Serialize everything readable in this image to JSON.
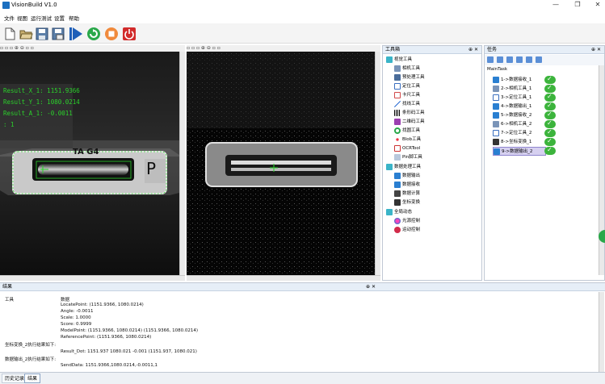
{
  "window": {
    "title": "VisionBuild V1.0",
    "min": "—",
    "max": "❐",
    "close": "✕"
  },
  "menu": [
    "文件",
    "视图",
    "运行测试",
    "设置",
    "帮助"
  ],
  "toolbar": [
    {
      "name": "new-file",
      "icon": "new-file-icon",
      "color": "#ffffff"
    },
    {
      "name": "open",
      "icon": "folder-open-icon",
      "color": "#d9c28a"
    },
    {
      "name": "save",
      "icon": "save-icon",
      "color": "#5c7fa8"
    },
    {
      "name": "save-as",
      "icon": "save-as-icon",
      "color": "#5c7fa8"
    },
    {
      "name": "run",
      "icon": "play-icon",
      "color": "#1f5fb8"
    },
    {
      "name": "run-loop",
      "icon": "loop-run-icon",
      "color": "#2aa84a"
    },
    {
      "name": "stop",
      "icon": "stop-icon",
      "color": "#f08a3c"
    },
    {
      "name": "power",
      "icon": "power-icon",
      "color": "#d22b2b"
    }
  ],
  "overlay": {
    "x": "Result_X_1: 1151.9366",
    "y": "Result_Y_1: 1080.0214",
    "a": "Result_A_1: -0.0011",
    "n": ": 1",
    "label_ta": "TA G4",
    "label_p": "P"
  },
  "toolbox": {
    "title": "工具箱",
    "groups": [
      {
        "label": "视觉工具",
        "items": [
          "相机工具",
          "预处理工具",
          "定位工具",
          "卡尺工具",
          "找线工具",
          "条形码工具",
          "二维码工具",
          "找圆工具",
          "Blob工具",
          "OCRTool",
          "Pin脚工具"
        ]
      },
      {
        "label": "数据处理工具",
        "items": [
          "数据输出",
          "数据接收",
          "数据计算",
          "坐标变换"
        ]
      },
      {
        "label": "全局动态",
        "items": [
          "光源控制",
          "运动控制"
        ]
      }
    ]
  },
  "tasks": {
    "title": "任务",
    "root": "MainTask",
    "items": [
      "1->数据接收_1",
      "2->相机工具_1",
      "3->定位工具_1",
      "4->数据输出_1",
      "5->数据接收_2",
      "6->相机工具_2",
      "7->定位工具_2",
      "8->坐标变换_1",
      "9->数据输出_2"
    ]
  },
  "results": {
    "title": "结果",
    "col_tool": "工具",
    "col_data": "数据",
    "lines": [
      "LocatePoint:      (1151.9366, 1080.0214)",
      "Angle:      -0.0011",
      "Scale:      1.0000",
      "Score:      0.9999",
      "ModelPoint:      (1151.9366, 1080.0214)    (1151.9366, 1080.0214)",
      "ReferencePoint:      (1151.9366, 1080.0214)"
    ],
    "section2": "坐标变换_2执行结果如下:",
    "line2": "Result_Dot:      1151.937      1080.021      -0.001      (1151.937, 1080.021)",
    "section3": "数据输出_2执行结果如下:",
    "line3": "SendData:      1151.9366,1080.0214,-0.0011,1"
  },
  "bottom_tabs": [
    "历史记录",
    "结果"
  ]
}
